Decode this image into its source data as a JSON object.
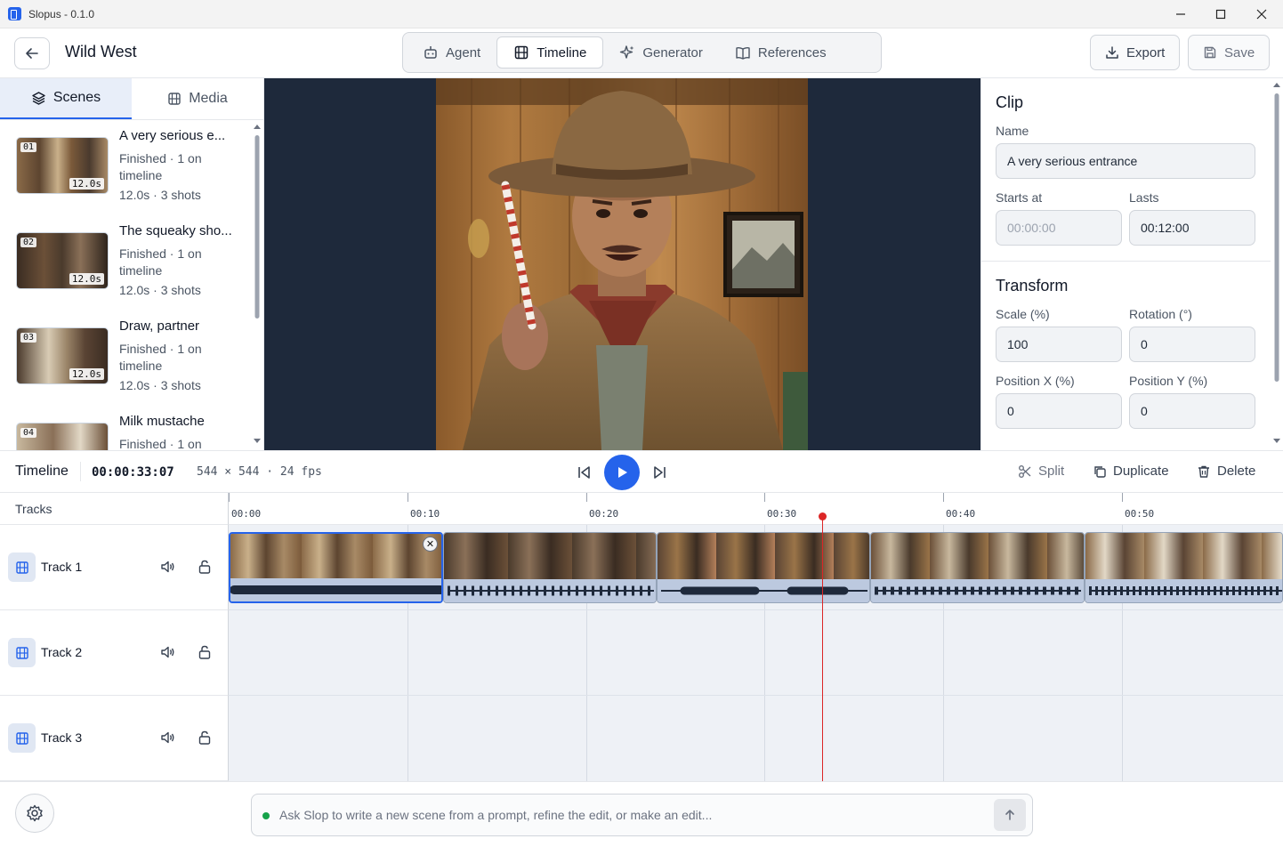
{
  "window": {
    "title": "Slopus - 0.1.0"
  },
  "header": {
    "project_title": "Wild West",
    "tabs": [
      {
        "label": "Agent",
        "icon": "robot-icon"
      },
      {
        "label": "Timeline",
        "icon": "film-icon",
        "active": true
      },
      {
        "label": "Generator",
        "icon": "sparkles-icon"
      },
      {
        "label": "References",
        "icon": "book-icon"
      }
    ],
    "export_label": "Export",
    "save_label": "Save"
  },
  "left_panel": {
    "tabs": [
      {
        "label": "Scenes",
        "icon": "layers-icon",
        "active": true
      },
      {
        "label": "Media",
        "icon": "film-icon"
      }
    ],
    "scenes": [
      {
        "num": "01",
        "duration": "12.0s",
        "title": "A very serious e...",
        "status": "Finished · 1 on timeline",
        "meta": "12.0s · 3 shots"
      },
      {
        "num": "02",
        "duration": "12.0s",
        "title": "The squeaky sho...",
        "status": "Finished · 1 on timeline",
        "meta": "12.0s · 3 shots"
      },
      {
        "num": "03",
        "duration": "12.0s",
        "title": "Draw, partner",
        "status": "Finished · 1 on timeline",
        "meta": "12.0s · 3 shots"
      },
      {
        "num": "04",
        "duration": "",
        "title": "Milk mustache",
        "status": "Finished · 1 on",
        "meta": ""
      }
    ]
  },
  "inspector": {
    "clip_title": "Clip",
    "name_label": "Name",
    "name_value": "A very serious entrance",
    "starts_label": "Starts at",
    "starts_value": "00:00:00",
    "lasts_label": "Lasts",
    "lasts_value": "00:12:00",
    "transform_title": "Transform",
    "scale_label": "Scale (%)",
    "scale_value": "100",
    "rotation_label": "Rotation (°)",
    "rotation_value": "0",
    "posx_label": "Position X (%)",
    "posx_value": "0",
    "posy_label": "Position Y (%)",
    "posy_value": "0"
  },
  "timeline": {
    "title": "Timeline",
    "timecode": "00:00:33:07",
    "format": "544 × 544 · 24 fps",
    "split_label": "Split",
    "duplicate_label": "Duplicate",
    "delete_label": "Delete",
    "tracks_label": "Tracks",
    "ruler": [
      "00:00",
      "00:10",
      "00:20",
      "00:30",
      "00:40",
      "00:50"
    ],
    "tracks": [
      {
        "name": "Track 1"
      },
      {
        "name": "Track 2"
      },
      {
        "name": "Track 3"
      }
    ]
  },
  "prompt": {
    "placeholder": "Ask Slop to write a new scene from a prompt, refine the edit, or make an edit..."
  },
  "colors": {
    "accent": "#2563eb",
    "playhead": "#dc2626",
    "status_ok": "#16a34a"
  }
}
